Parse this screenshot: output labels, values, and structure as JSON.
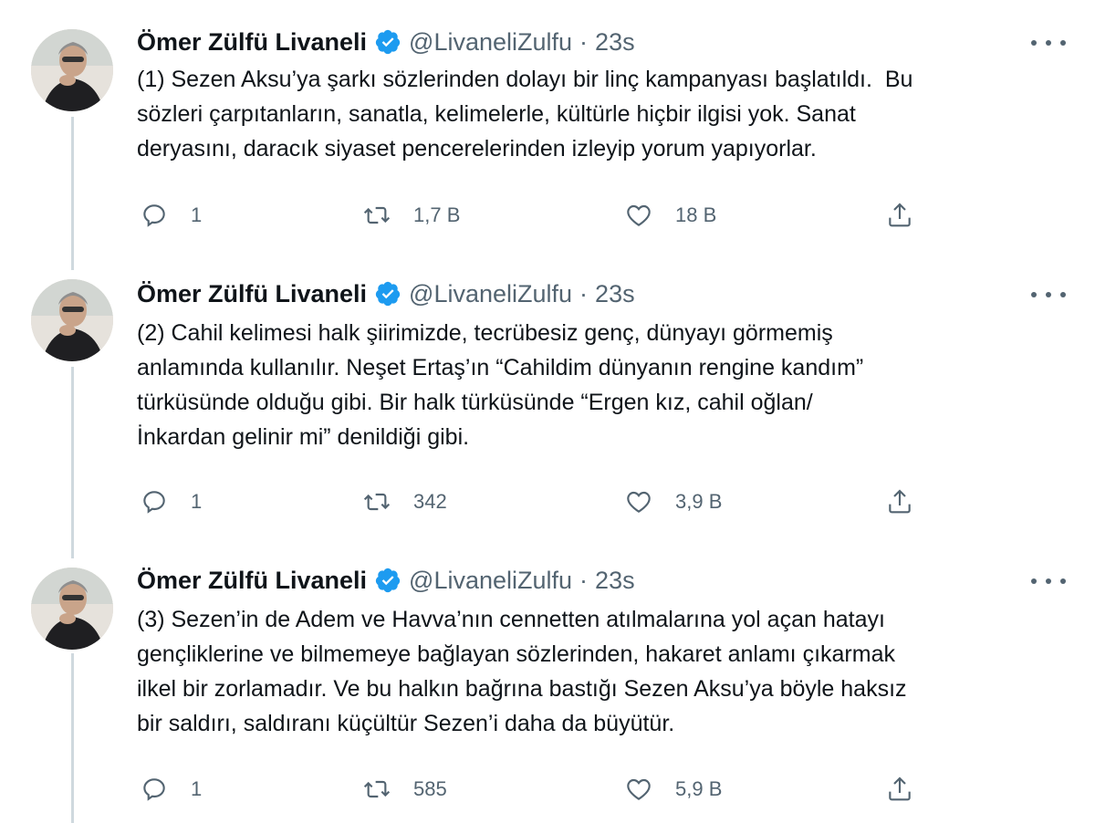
{
  "tweets": [
    {
      "author_name": "Ömer Zülfü Livaneli",
      "handle": "@LivaneliZulfu",
      "separator": "·",
      "time": "23s",
      "text": "(1) Sezen Aksu’ya şarkı sözlerinden dolayı bir linç kampanyası başlatıldı.  Bu\nsözleri çarpıtanların, sanatla, kelimelerle, kültürle hiçbir ilgisi yok. Sanat\nderyasını, daracık siyaset pencerelerinden izleyip yorum yapıyorlar.",
      "replies": "1",
      "retweets": "1,7 B",
      "likes": "18 B"
    },
    {
      "author_name": "Ömer Zülfü Livaneli",
      "handle": "@LivaneliZulfu",
      "separator": "·",
      "time": "23s",
      "text": "(2) Cahil kelimesi halk şiirimizde, tecrübesiz genç, dünyayı görmemiş\nanlamında kullanılır. Neşet Ertaş’ın “Cahildim dünyanın rengine kandım”\ntürküsünde olduğu gibi. Bir halk türküsünde “Ergen kız, cahil oğlan/\nİnkardan gelinir mi” denildiği gibi.",
      "replies": "1",
      "retweets": "342",
      "likes": "3,9 B"
    },
    {
      "author_name": "Ömer Zülfü Livaneli",
      "handle": "@LivaneliZulfu",
      "separator": "·",
      "time": "23s",
      "text": "(3) Sezen’in de Adem ve Havva’nın cennetten atılmalarına yol açan hatayı\ngençliklerine ve bilmemeye bağlayan sözlerinden, hakaret anlamı çıkarmak\nilkel bir zorlamadır. Ve bu halkın bağrına bastığı Sezen Aksu’ya böyle haksız\nbir saldırı, saldıranı küçültür Sezen’i daha da büyütür.",
      "replies": "1",
      "retweets": "585",
      "likes": "5,9 B"
    }
  ],
  "icons": {
    "verified": "verified-badge-icon",
    "reply": "reply-icon",
    "retweet": "retweet-icon",
    "like": "heart-icon",
    "share": "share-icon",
    "more": "more-icon"
  },
  "colors": {
    "verified_blue": "#1d9bf0",
    "secondary_text": "#536471",
    "thread_line": "#cfd9de"
  }
}
